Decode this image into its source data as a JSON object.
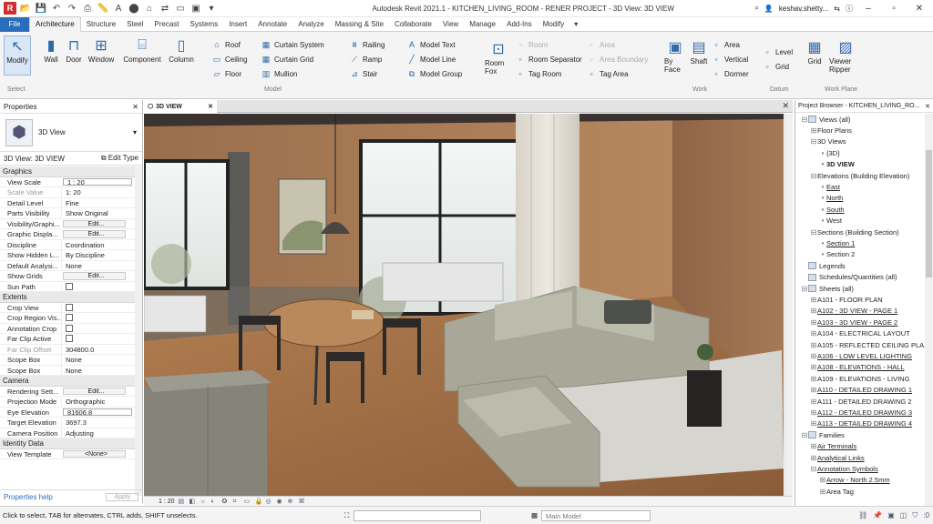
{
  "app": {
    "title": "Autodesk Revit 2021.1 - KITCHEN_LIVING_ROOM - RENER PROJECT - 3D View: 3D VIEW",
    "user": "keshav.shetty...",
    "brand_color": "#2a6ebb"
  },
  "quick_access": [
    "R",
    "📂",
    "💾",
    "↶",
    "↷",
    "⎙",
    "📏",
    "A",
    "⬤",
    "⌂",
    "⇄",
    "▭",
    "▣",
    "▾"
  ],
  "tabs": [
    "File",
    "Architecture",
    "Structure",
    "Steel",
    "Precast",
    "Systems",
    "Insert",
    "Annotate",
    "Analyze",
    "Massing & Site",
    "Collaborate",
    "View",
    "Manage",
    "Add-Ins",
    "Modify"
  ],
  "active_tab": "Architecture",
  "ribbon": {
    "big_buttons": [
      {
        "label": "Modify",
        "icon": "pointer-icon",
        "glyph": "↖"
      },
      {
        "label": "Wall",
        "icon": "wall-icon",
        "glyph": "▮"
      },
      {
        "label": "Door",
        "icon": "door-icon",
        "glyph": "⊓"
      },
      {
        "label": "Window",
        "icon": "window-icon",
        "glyph": "⊞"
      },
      {
        "label": "Component",
        "icon": "component-icon",
        "glyph": "⌸"
      },
      {
        "label": "Column",
        "icon": "column-icon",
        "glyph": "▯"
      }
    ],
    "build_small": [
      {
        "label": "Roof",
        "glyph": "⌂"
      },
      {
        "label": "Ceiling",
        "glyph": "▭"
      },
      {
        "label": "Floor",
        "glyph": "▱"
      },
      {
        "label": "Curtain System",
        "glyph": "▦"
      },
      {
        "label": "Curtain Grid",
        "glyph": "▦"
      },
      {
        "label": "Mullion",
        "glyph": "▥"
      }
    ],
    "circulation": [
      {
        "label": "Railing",
        "glyph": "⩩"
      },
      {
        "label": "Ramp",
        "glyph": "⟋"
      },
      {
        "label": "Stair",
        "glyph": "⊿"
      }
    ],
    "model": [
      {
        "label": "Model Text",
        "glyph": "A"
      },
      {
        "label": "Model Line",
        "glyph": "╱"
      },
      {
        "label": "Model Group",
        "glyph": "⧉"
      }
    ],
    "room_big": {
      "label": "Room Fox",
      "glyph": "⊡"
    },
    "room_small": [
      {
        "label": "Room",
        "disabled": true
      },
      {
        "label": "Room Separator",
        "disabled": false
      },
      {
        "label": "Tag Room",
        "disabled": false
      },
      {
        "label": "Area",
        "disabled": true
      },
      {
        "label": "Area Boundary",
        "disabled": true
      },
      {
        "label": "Tag Area",
        "disabled": false
      }
    ],
    "opening_big": [
      {
        "label": "By Face",
        "glyph": "▣"
      },
      {
        "label": "Shaft",
        "glyph": "▤"
      }
    ],
    "opening_small": [
      "Area",
      "Vertical",
      "Dormer"
    ],
    "datum": [
      "Level",
      "Grid"
    ],
    "work_plane": [
      {
        "label": "Grid",
        "glyph": "▦"
      },
      {
        "label": "Viewer Ripper",
        "glyph": "▨"
      }
    ],
    "panel_labels": [
      "Select",
      "Model",
      "Work",
      "Datum",
      "Work Plane"
    ]
  },
  "properties": {
    "title": "Properties",
    "type_name": "3D View",
    "selector": "3D View: 3D VIEW",
    "edit_type": "Edit Type",
    "groups": [
      {
        "name": "Graphics",
        "rows": [
          {
            "k": "View Scale",
            "v": "1 : 20",
            "kind": "box"
          },
          {
            "k": "Scale Value",
            "v": "1:    20",
            "kind": "grey"
          },
          {
            "k": "Detail Level",
            "v": "Fine"
          },
          {
            "k": "Parts Visibility",
            "v": "Show Original"
          },
          {
            "k": "Visibility/Graphi...",
            "v": "Edit...",
            "kind": "btn"
          },
          {
            "k": "Graphic Displa...",
            "v": "Edit...",
            "kind": "btn"
          },
          {
            "k": "Discipline",
            "v": "Coordination"
          },
          {
            "k": "Show Hidden L...",
            "v": "By Discipline"
          },
          {
            "k": "Default Analysi...",
            "v": "None"
          },
          {
            "k": "Show Grids",
            "v": "Edit...",
            "kind": "btn"
          },
          {
            "k": "Sun Path",
            "v": "",
            "kind": "chk"
          }
        ]
      },
      {
        "name": "Extents",
        "rows": [
          {
            "k": "Crop View",
            "v": "",
            "kind": "chk"
          },
          {
            "k": "Crop Region Vis...",
            "v": "",
            "kind": "chk"
          },
          {
            "k": "Annotation Crop",
            "v": "",
            "kind": "chk"
          },
          {
            "k": "Far Clip Active",
            "v": "",
            "kind": "chk"
          },
          {
            "k": "Far Clip Offset",
            "v": "304800.0",
            "kind": "grey"
          },
          {
            "k": "Scope Box",
            "v": "None"
          },
          {
            "k": "Scope Box",
            "v": "None"
          }
        ]
      },
      {
        "name": "Camera",
        "rows": [
          {
            "k": "Rendering Sett...",
            "v": "Edit...",
            "kind": "btn"
          },
          {
            "k": "Projection Mode",
            "v": "Orthographic"
          },
          {
            "k": "Eye Elevation",
            "v": "81606.8",
            "kind": "box"
          },
          {
            "k": "Target Elevation",
            "v": "3697.3"
          },
          {
            "k": "Camera Position",
            "v": "Adjusting"
          }
        ]
      },
      {
        "name": "Identity Data",
        "rows": [
          {
            "k": "View Template",
            "v": "<None>",
            "kind": "btn"
          }
        ]
      }
    ],
    "help": "Properties help",
    "apply": "Apply"
  },
  "view": {
    "tab_label": "3D VIEW",
    "scale": "1 : 20"
  },
  "browser": {
    "title": "Project Browser - KITCHEN_LIVING_RO...",
    "items": [
      {
        "label": "Views (all)",
        "lvl": 0,
        "tg": "⊟",
        "folder": true
      },
      {
        "label": "Floor Plans",
        "lvl": 1,
        "tg": "⊞"
      },
      {
        "label": "3D Views",
        "lvl": 1,
        "tg": "⊟"
      },
      {
        "label": "{3D}",
        "lvl": 2,
        "tg": "•"
      },
      {
        "label": "3D VIEW",
        "lvl": 2,
        "tg": "•",
        "bold": true
      },
      {
        "label": "Elevations (Building Elevation)",
        "lvl": 1,
        "tg": "⊟"
      },
      {
        "label": "East",
        "lvl": 2,
        "tg": "•",
        "u": true
      },
      {
        "label": "North",
        "lvl": 2,
        "tg": "•",
        "u": true
      },
      {
        "label": "South",
        "lvl": 2,
        "tg": "•",
        "u": true
      },
      {
        "label": "West",
        "lvl": 2,
        "tg": "•"
      },
      {
        "label": "Sections (Building Section)",
        "lvl": 1,
        "tg": "⊟"
      },
      {
        "label": "Section 1",
        "lvl": 2,
        "tg": "•",
        "u": true
      },
      {
        "label": "Section 2",
        "lvl": 2,
        "tg": "•"
      },
      {
        "label": "Legends",
        "lvl": 0,
        "tg": " ",
        "folder": true
      },
      {
        "label": "Schedules/Quantities (all)",
        "lvl": 0,
        "tg": " ",
        "folder": true
      },
      {
        "label": "Sheets (all)",
        "lvl": 0,
        "tg": "⊟",
        "folder": true
      },
      {
        "label": "A101 - FLOOR PLAN",
        "lvl": 1,
        "tg": "⊞"
      },
      {
        "label": "A102 - 3D VIEW - PAGE 1",
        "lvl": 1,
        "tg": "⊞",
        "u": true
      },
      {
        "label": "A103 - 3D VIEW - PAGE 2",
        "lvl": 1,
        "tg": "⊞",
        "u": true
      },
      {
        "label": "A104 - ELECTRICAL LAYOUT",
        "lvl": 1,
        "tg": "⊞"
      },
      {
        "label": "A105 - REFLECTED CEILING PLA...",
        "lvl": 1,
        "tg": "⊞"
      },
      {
        "label": "A106 - LOW LEVEL LIGHTING",
        "lvl": 1,
        "tg": "⊞",
        "u": true
      },
      {
        "label": "A108 - ELEVATIONS - HALL",
        "lvl": 1,
        "tg": "⊞",
        "u": true
      },
      {
        "label": "A109 - ELEVATIONS - LIVING",
        "lvl": 1,
        "tg": "⊞"
      },
      {
        "label": "A110 - DETAILED DRAWING 1",
        "lvl": 1,
        "tg": "⊞",
        "u": true
      },
      {
        "label": "A111 - DETAILED DRAWING 2",
        "lvl": 1,
        "tg": "⊞"
      },
      {
        "label": "A112 - DETAILED DRAWING 3",
        "lvl": 1,
        "tg": "⊞",
        "u": true
      },
      {
        "label": "A113 - DETAILED DRAWING 4",
        "lvl": 1,
        "tg": "⊞",
        "u": true
      },
      {
        "label": "Families",
        "lvl": 0,
        "tg": "⊟",
        "folder": true
      },
      {
        "label": "Air Terminals",
        "lvl": 1,
        "tg": "⊞",
        "u": true
      },
      {
        "label": "Analytical Links",
        "lvl": 1,
        "tg": "⊞",
        "u": true
      },
      {
        "label": "Annotation Symbols",
        "lvl": 1,
        "tg": "⊟",
        "u": true
      },
      {
        "label": "Arrow - North 2.5mm",
        "lvl": 2,
        "tg": "⊞",
        "u": true
      },
      {
        "label": "Area Tag",
        "lvl": 2,
        "tg": "⊞"
      }
    ]
  },
  "status": {
    "hint": "Click to select, TAB for alternates, CTRL adds, SHIFT unselects.",
    "model": "Main Model",
    "zero": ":0"
  }
}
